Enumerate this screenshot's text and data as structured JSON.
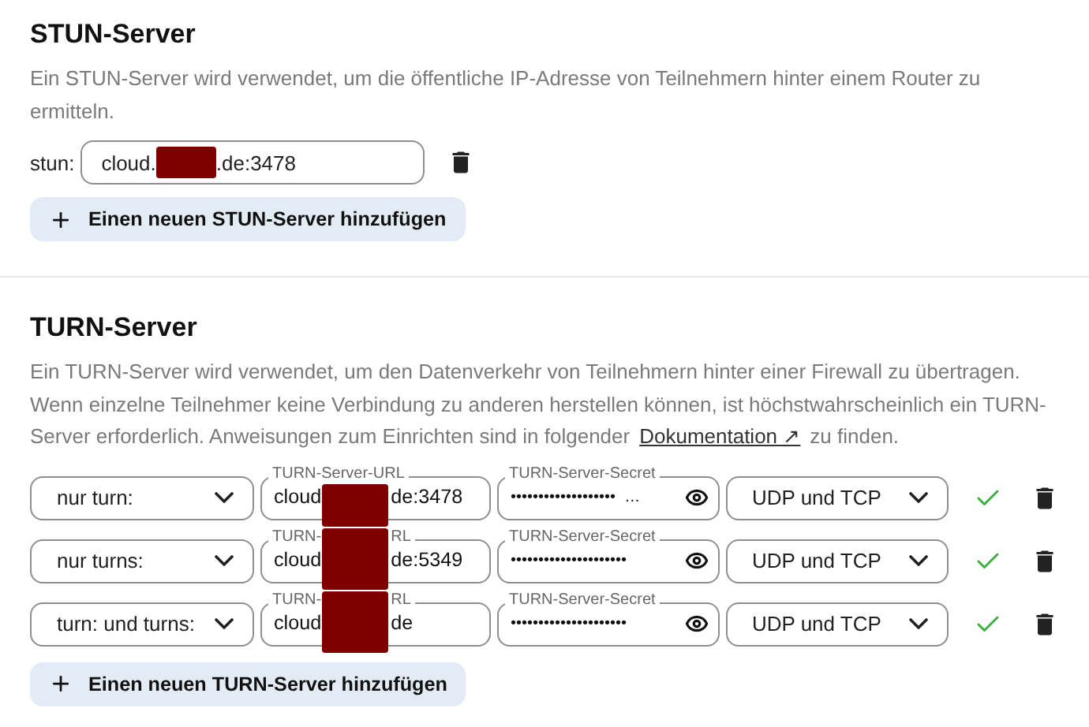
{
  "stun": {
    "title": "STUN-Server",
    "description": "Ein STUN-Server wird verwendet, um die öffentliche IP-Adresse von Teilnehmern hinter einem Router zu ermitteln.",
    "servers": [
      {
        "prefix": "stun:",
        "value_parts": [
          "cloud.",
          ".de:3478"
        ]
      }
    ],
    "add_button": "Einen neuen STUN-Server hinzufügen"
  },
  "turn": {
    "title": "TURN-Server",
    "description_before": "Ein TURN-Server wird verwendet, um den Datenverkehr von Teilnehmern hinter einer Firewall zu übertragen. Wenn einzelne Teilnehmer keine Verbindung zu anderen herstellen können, ist höchstwahrscheinlich ein TURN-Server erforderlich. Anweisungen zum Einrichten sind in folgender",
    "link": "Dokumentation ↗",
    "description_after": "zu finden.",
    "servers": [
      {
        "scheme": "nur turn:",
        "url_label_parts": [
          "TURN-Server-URL"
        ],
        "url_parts": [
          "cloud",
          "de:3478"
        ],
        "label_covered": false,
        "secret_label": "TURN-Server-Secret",
        "secret": "•••••••••••••••••••  …",
        "protocol": "UDP und TCP",
        "valid": true
      },
      {
        "scheme": "nur turns:",
        "url_label_parts": [
          "TURN-",
          "RL"
        ],
        "url_parts": [
          "cloud",
          "de:5349"
        ],
        "label_covered": true,
        "secret_label": "TURN-Server-Secret",
        "secret": "•••••••••••••••••••••",
        "protocol": "UDP und TCP",
        "valid": true
      },
      {
        "scheme": "turn: und turns:",
        "url_label_parts": [
          "TURN-",
          "RL"
        ],
        "url_parts": [
          "cloud",
          "de"
        ],
        "label_covered": true,
        "secret_label": "TURN-Server-Secret",
        "secret": "•••••••••••••••••••••",
        "protocol": "UDP und TCP",
        "valid": true
      }
    ],
    "add_button": "Einen neuen TURN-Server hinzufügen"
  }
}
